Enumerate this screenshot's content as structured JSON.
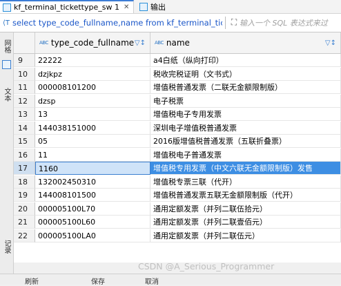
{
  "tabs": [
    {
      "label": "kf_terminal_tickettype_sw 1",
      "icon": "table-icon",
      "active": true
    },
    {
      "label": "输出",
      "icon": "output-icon",
      "active": false
    }
  ],
  "sqlbar": {
    "sql": "select type_code_fullname,name from kf_terminal_tic",
    "filter_placeholder": "输入一个 SQL 表达式来过"
  },
  "side": {
    "grid_label": "网格",
    "text_label": "文本",
    "record_label": "记录"
  },
  "columns": [
    {
      "label": "type_code_fullname",
      "type_badge": "ABC"
    },
    {
      "label": "name",
      "type_badge": "ABC"
    }
  ],
  "rows": [
    {
      "n": "9",
      "code": "22222",
      "name": "a4白纸（纵向打印）"
    },
    {
      "n": "10",
      "code": "dzjkpz",
      "name": "税收完税证明（文书式）"
    },
    {
      "n": "11",
      "code": "000008101200",
      "name": "增值税普通发票（二联无金额限制版）"
    },
    {
      "n": "12",
      "code": "dzsp",
      "name": "电子税票"
    },
    {
      "n": "13",
      "code": "13",
      "name": "增值税电子专用发票"
    },
    {
      "n": "14",
      "code": "144038151000",
      "name": "深圳电子增值税普通发票"
    },
    {
      "n": "15",
      "code": "05",
      "name": "2016版增值税普通发票（五联折叠票）"
    },
    {
      "n": "16",
      "code": "11",
      "name": "增值税电子普通发票"
    },
    {
      "n": "17",
      "code": "1160",
      "name": "增值税专用发票（中文六联无金额限制版）发售",
      "selected": true
    },
    {
      "n": "18",
      "code": "132002450310",
      "name": "增值税专票三联（代开）"
    },
    {
      "n": "19",
      "code": "144008101500",
      "name": "增值税普通发票五联无金额限制版（代开）"
    },
    {
      "n": "20",
      "code": "000005100L70",
      "name": "通用定额发票（并列二联伍拾元）"
    },
    {
      "n": "21",
      "code": "000005100L60",
      "name": "通用定额发票（并列二联壹佰元）"
    },
    {
      "n": "22",
      "code": "000005100LA0",
      "name": "通用定额发票（并列二联伍元）"
    }
  ],
  "bottom": {
    "refresh": "刷新",
    "save": "保存",
    "cancel": "取消"
  },
  "watermark": "CSDN @A_Serious_Programmer",
  "colors": {
    "accent": "#3d8ee3",
    "sql_text": "#1a56c8"
  }
}
